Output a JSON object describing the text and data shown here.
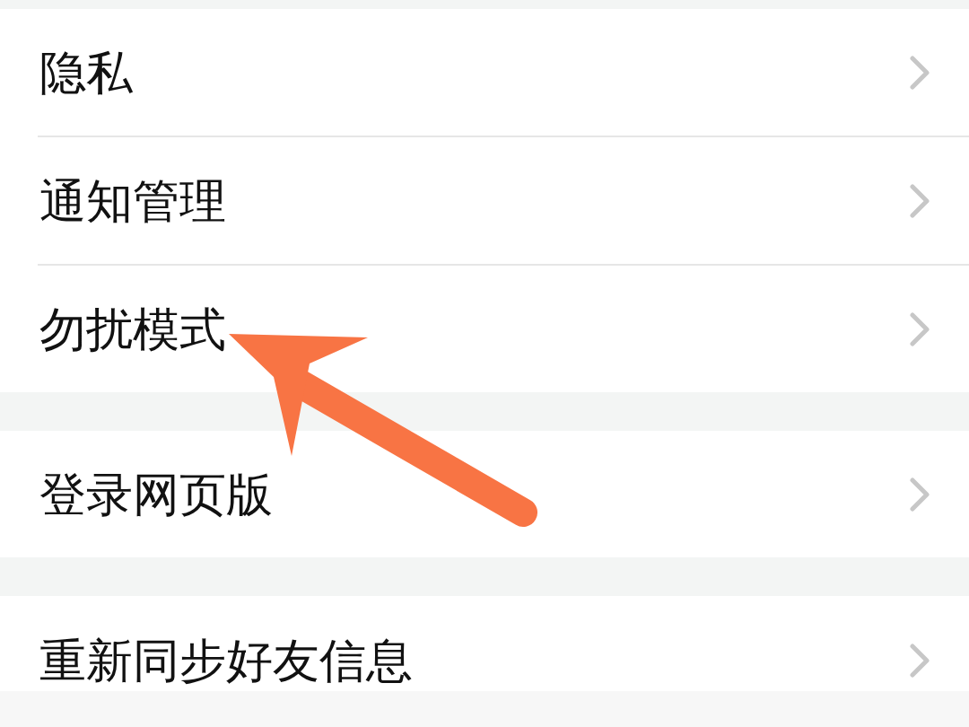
{
  "groups": [
    {
      "items": [
        {
          "label": "隐私"
        },
        {
          "label": "通知管理"
        },
        {
          "label": "勿扰模式"
        }
      ]
    },
    {
      "items": [
        {
          "label": "登录网页版"
        }
      ]
    },
    {
      "items": [
        {
          "label": "重新同步好友信息"
        }
      ]
    }
  ]
}
